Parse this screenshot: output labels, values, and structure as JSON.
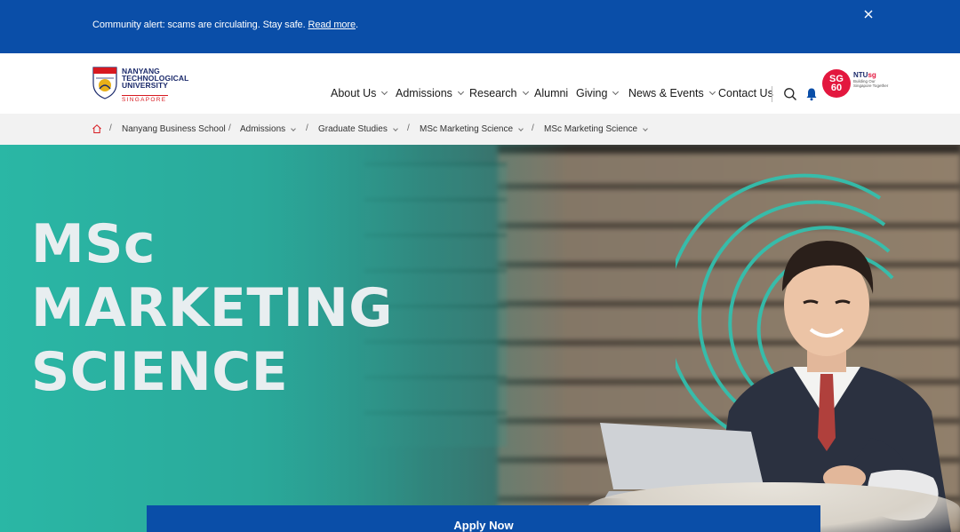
{
  "alert": {
    "text": "Community alert: scams are circulating. Stay safe.",
    "link": "Read more",
    "suffix": "."
  },
  "logo": {
    "line1": "NANYANG",
    "line2": "TECHNOLOGICAL",
    "line3": "UNIVERSITY",
    "sub": "SINGAPORE"
  },
  "nav": {
    "items": [
      {
        "label": "About Us"
      },
      {
        "label": "Admissions"
      },
      {
        "label": "Research"
      },
      {
        "label": "Alumni"
      },
      {
        "label": "Giving"
      },
      {
        "label": "News & Events"
      },
      {
        "label": "Contact Us"
      }
    ]
  },
  "badge": {
    "sg_top": "SG",
    "sg_bottom": "60",
    "ntu": "NTU",
    "sg": "sg",
    "tagline": "Building Our Singapore Together"
  },
  "breadcrumb": {
    "items": [
      {
        "label": "Nanyang Business School"
      },
      {
        "label": "Admissions"
      },
      {
        "label": "Graduate Studies"
      },
      {
        "label": "MSc Marketing Science"
      },
      {
        "label": "MSc Marketing Science"
      }
    ]
  },
  "hero": {
    "line1": "MSc",
    "line2": "MARKETING",
    "line3": "SCIENCE"
  },
  "cta": {
    "apply": "Apply Now"
  },
  "colors": {
    "brand_blue": "#0a4ea8",
    "teal": "#2ab7a5",
    "logo_red": "#d71920"
  }
}
